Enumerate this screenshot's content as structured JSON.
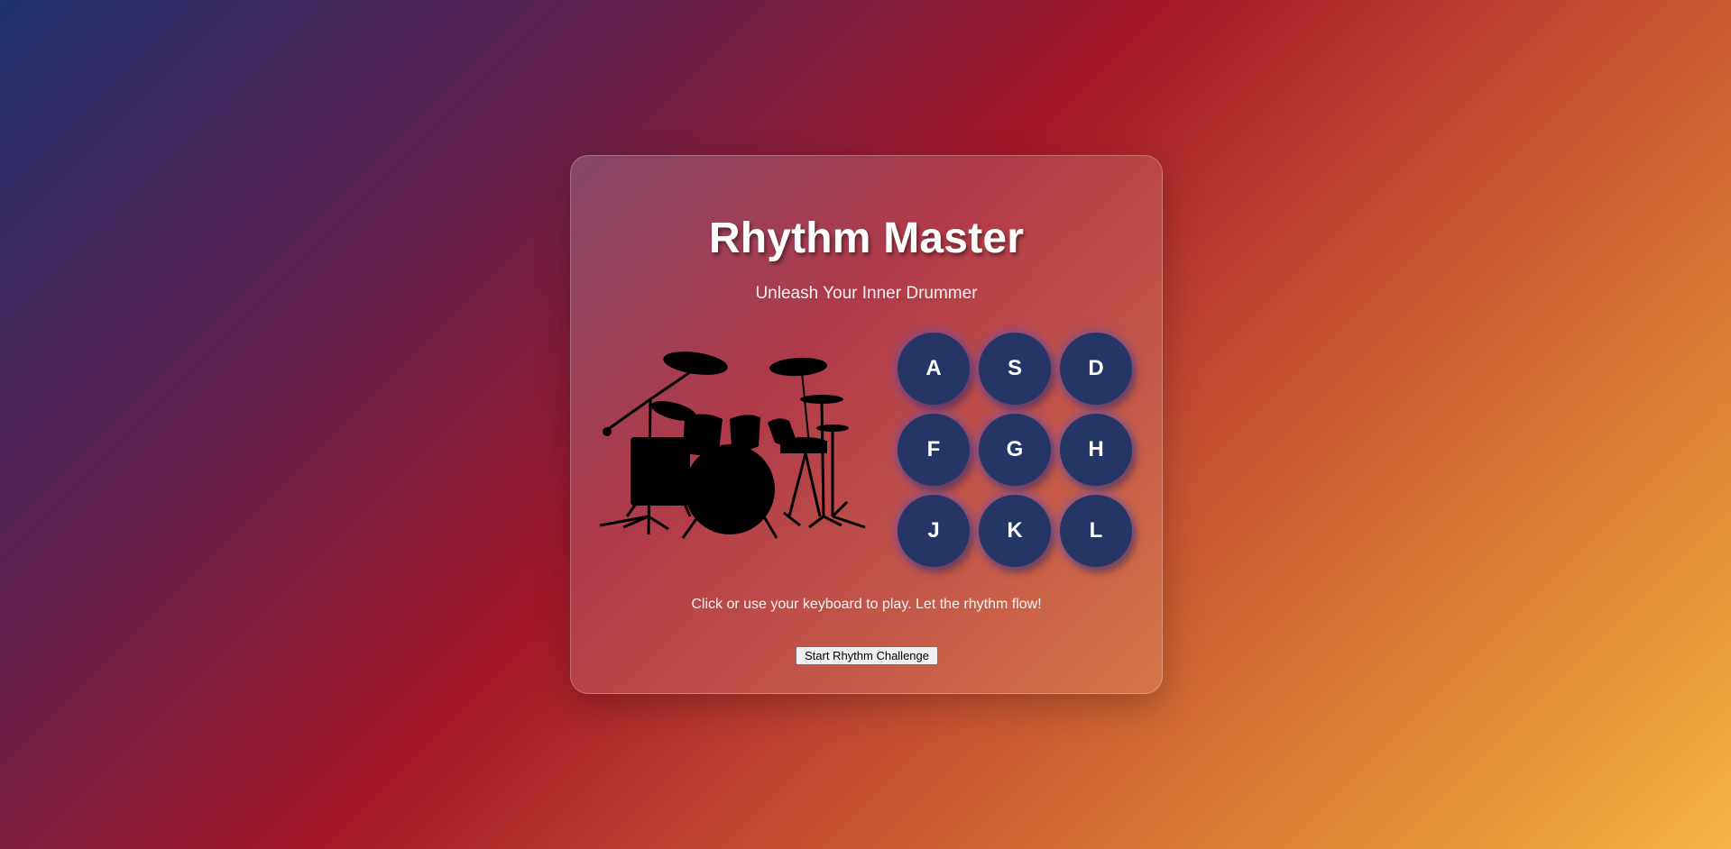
{
  "app": {
    "title": "Rhythm Master",
    "subtitle": "Unleash Your Inner Drummer"
  },
  "pads": [
    {
      "key": "A"
    },
    {
      "key": "S"
    },
    {
      "key": "D"
    },
    {
      "key": "F"
    },
    {
      "key": "G"
    },
    {
      "key": "H"
    },
    {
      "key": "J"
    },
    {
      "key": "K"
    },
    {
      "key": "L"
    }
  ],
  "instructions": "Click or use your keyboard to play. Let the rhythm flow!",
  "start_button": {
    "label": "Start Rhythm Challenge"
  },
  "colors": {
    "pad_bg": "#243566",
    "pad_glow": "#5a50c8",
    "background_start": "#1e3170",
    "background_mid": "#a3182a",
    "background_end": "#f6b443"
  },
  "icons": {
    "drum_kit": "drum-kit-silhouette"
  }
}
